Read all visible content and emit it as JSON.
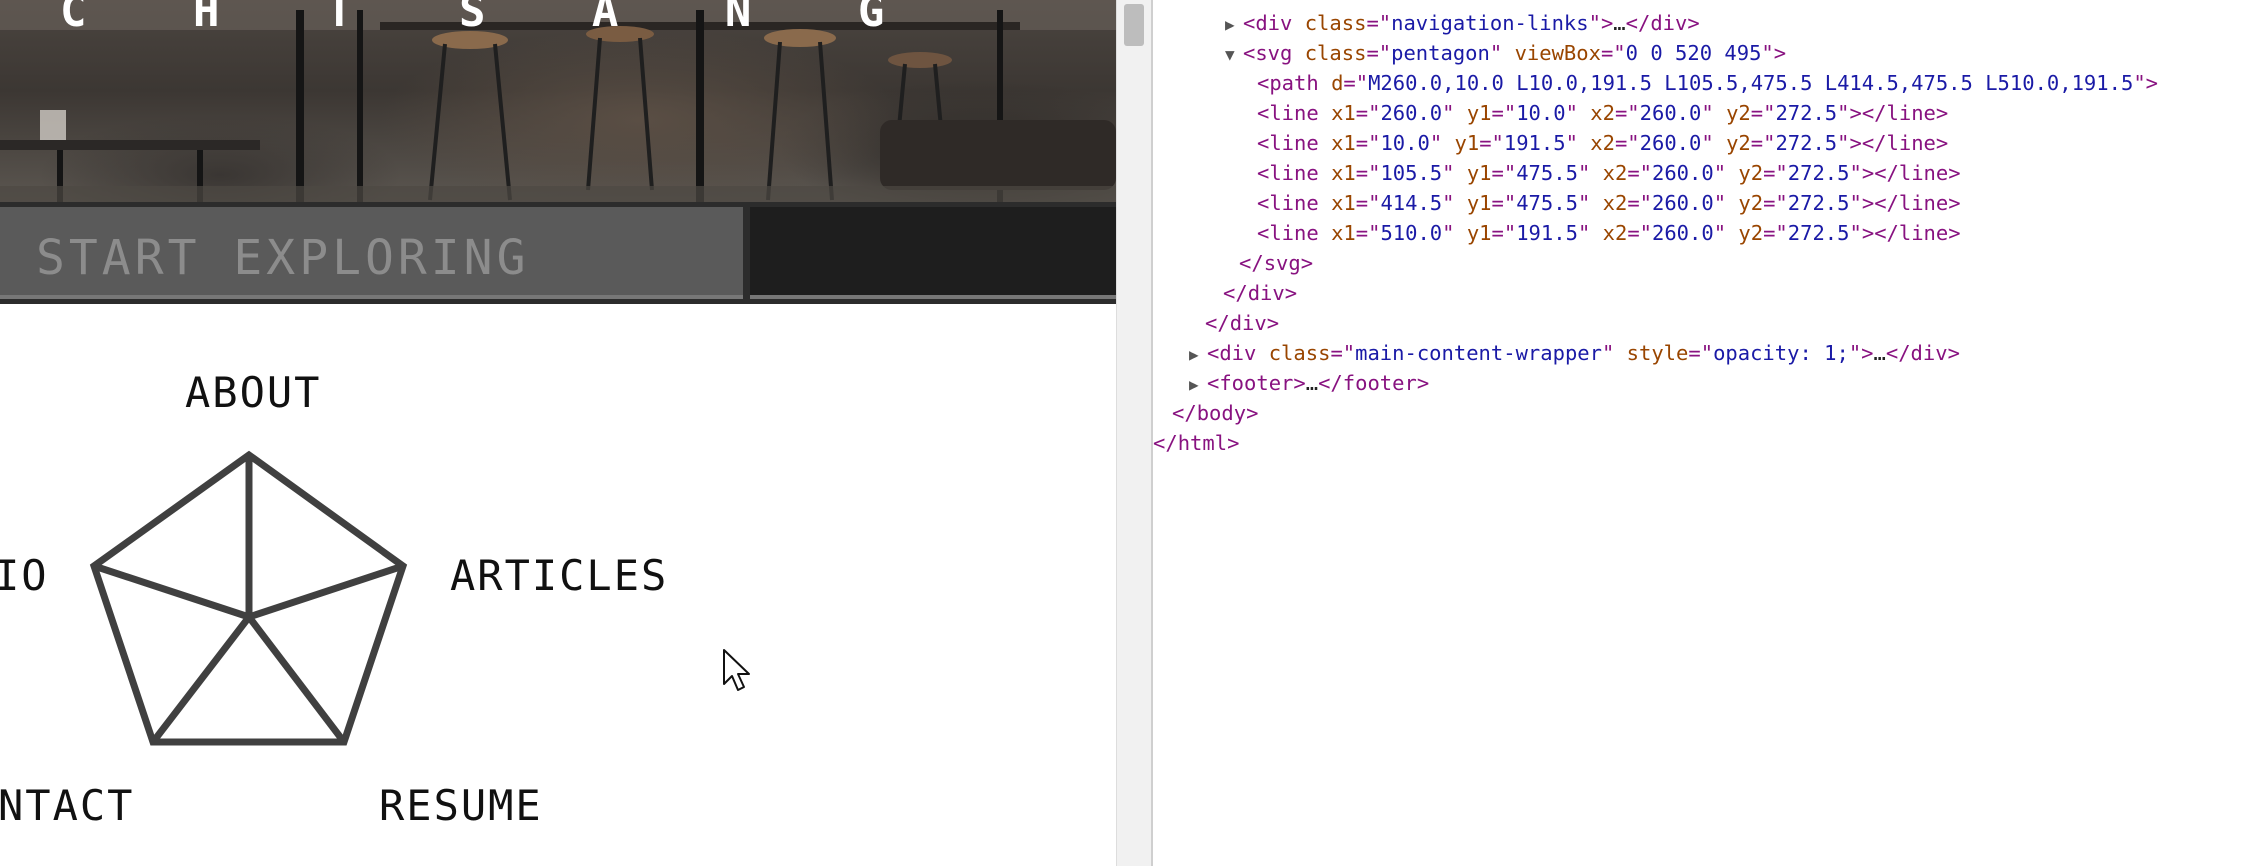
{
  "hero": {
    "title": "C H T S A N G"
  },
  "explore": {
    "label": "START EXPLORING"
  },
  "nav": {
    "about": "ABOUT",
    "articles": "ARTICLES",
    "resume": "RESUME",
    "contact_partial": "NTACT",
    "portfolio_partial": "IO"
  },
  "devtools": {
    "lines": [
      {
        "kind": "collapsed",
        "tag": "div",
        "attrs": [
          {
            "name": "class",
            "value": "navigation-links"
          }
        ],
        "rest": "…"
      },
      {
        "kind": "open-expanded",
        "tag": "svg",
        "attrs": [
          {
            "name": "class",
            "value": "pentagon"
          },
          {
            "name": "viewBox",
            "value": "0 0 520 495"
          }
        ]
      },
      {
        "kind": "leaf",
        "tag": "path",
        "attrs": [
          {
            "name": "d",
            "value": "M260.0,10.0 L10.0,191.5 L105.5,475.5 L414.5,475.5 L510.0,191.5"
          }
        ]
      },
      {
        "kind": "line",
        "tag": "line",
        "attrs": [
          {
            "name": "x1",
            "value": "260.0"
          },
          {
            "name": "y1",
            "value": "10.0"
          },
          {
            "name": "x2",
            "value": "260.0"
          },
          {
            "name": "y2",
            "value": "272.5"
          }
        ]
      },
      {
        "kind": "line",
        "tag": "line",
        "attrs": [
          {
            "name": "x1",
            "value": "10.0"
          },
          {
            "name": "y1",
            "value": "191.5"
          },
          {
            "name": "x2",
            "value": "260.0"
          },
          {
            "name": "y2",
            "value": "272.5"
          }
        ]
      },
      {
        "kind": "line",
        "tag": "line",
        "attrs": [
          {
            "name": "x1",
            "value": "105.5"
          },
          {
            "name": "y1",
            "value": "475.5"
          },
          {
            "name": "x2",
            "value": "260.0"
          },
          {
            "name": "y2",
            "value": "272.5"
          }
        ]
      },
      {
        "kind": "line",
        "tag": "line",
        "attrs": [
          {
            "name": "x1",
            "value": "414.5"
          },
          {
            "name": "y1",
            "value": "475.5"
          },
          {
            "name": "x2",
            "value": "260.0"
          },
          {
            "name": "y2",
            "value": "272.5"
          }
        ]
      },
      {
        "kind": "line",
        "tag": "line",
        "attrs": [
          {
            "name": "x1",
            "value": "510.0"
          },
          {
            "name": "y1",
            "value": "191.5"
          },
          {
            "name": "x2",
            "value": "260.0"
          },
          {
            "name": "y2",
            "value": "272.5"
          }
        ]
      },
      {
        "kind": "close",
        "tag": "svg"
      },
      {
        "kind": "close",
        "tag": "div"
      },
      {
        "kind": "close",
        "tag": "div"
      },
      {
        "kind": "collapsed",
        "tag": "div",
        "attrs": [
          {
            "name": "class",
            "value": "main-content-wrapper"
          },
          {
            "name": "style",
            "value": "opacity: 1;"
          }
        ],
        "rest": "…"
      },
      {
        "kind": "collapsed",
        "tag": "footer",
        "attrs": [],
        "rest": "…"
      },
      {
        "kind": "close",
        "tag": "body"
      },
      {
        "kind": "close",
        "tag": "html"
      }
    ]
  },
  "colors": {
    "tag": "#881280",
    "attr_name": "#994500",
    "attr_value": "#1a1aa6",
    "pentagon_stroke": "#404040"
  }
}
